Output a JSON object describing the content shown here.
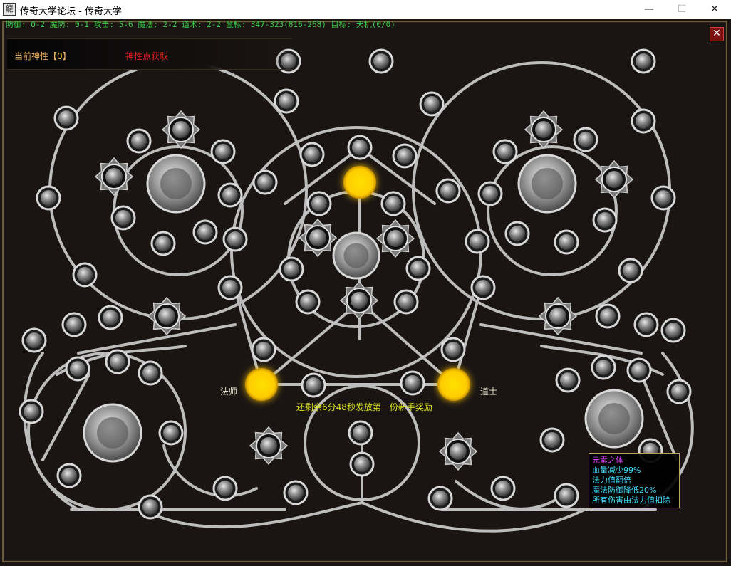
{
  "window": {
    "icon_glyph": "龍",
    "title": "传奇大学论坛 - 传奇大学",
    "minimize": "—",
    "maximize": "☐",
    "close": "✕"
  },
  "status_line": "防御: 0-2 魔防: 0-1 攻击: 5-6 魔法: 2-2 道术: 2-2 鼠标: 347-323(816-268) 目标: 天机(0/0)",
  "points": {
    "label": "当前神性【",
    "value": "0",
    "suffix": "】",
    "acquire_link": "神性点获取"
  },
  "panel_close": "✕",
  "labels": {
    "mage": "法师",
    "taoist": "道士"
  },
  "notice": "还剩余6分48秒发放第一份新手奖励",
  "tooltip": {
    "title": "元素之体",
    "lines": [
      "血量减少99%",
      "法力值翻倍",
      "魔法防御降低20%",
      "所有伤害由法力值扣除"
    ]
  },
  "colors": {
    "accent_yellow": "#ffcc00",
    "path": "#bfbfbf",
    "status_green": "#3bd14a",
    "link_red": "#e02020"
  },
  "icons": {
    "node_small": "round-rune-icon",
    "node_large": "medallion-icon",
    "node_star": "star-badge-icon",
    "core": "glowing-core-icon"
  }
}
